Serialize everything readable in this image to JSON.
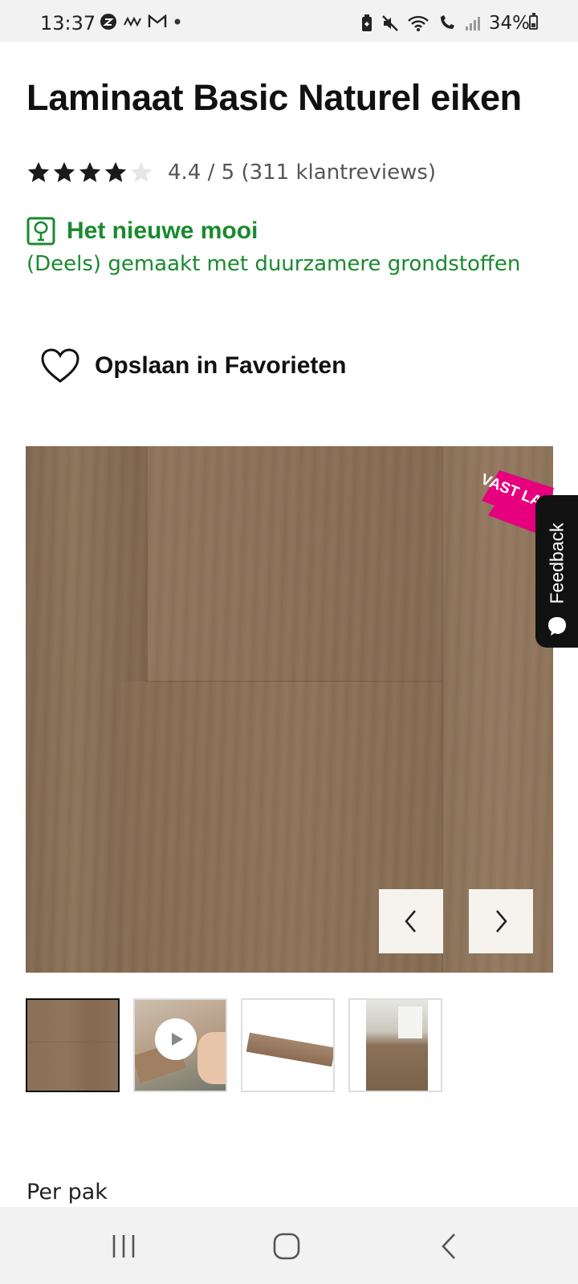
{
  "status_bar": {
    "time": "13:37",
    "battery": "34%",
    "battery_level": 0.34
  },
  "product": {
    "title": "Laminaat Basic Naturel eiken",
    "rating": {
      "stars": 4.4,
      "text": "4.4 / 5 (311 klantreviews)"
    },
    "sustainability": {
      "title": "Het nieuwe mooi",
      "subtitle": "(Deels) gemaakt met duurzamere grondstoffen",
      "color": "#1a8a2e"
    },
    "favorite_label": "Opslaan in Favorieten",
    "badge_text": "VAST LAAG",
    "badge_color": "#e6007e",
    "per_pack_label": "Per pak"
  },
  "feedback_tab": {
    "label": "Feedback"
  },
  "gallery": {
    "thumbnails": [
      {
        "name": "laminate-closeup"
      },
      {
        "name": "installation-video"
      },
      {
        "name": "single-plank"
      },
      {
        "name": "room-interior"
      }
    ],
    "active_index": 0
  },
  "nav_bar": {
    "icons": [
      "recent-apps-icon",
      "home-icon",
      "back-icon"
    ]
  }
}
